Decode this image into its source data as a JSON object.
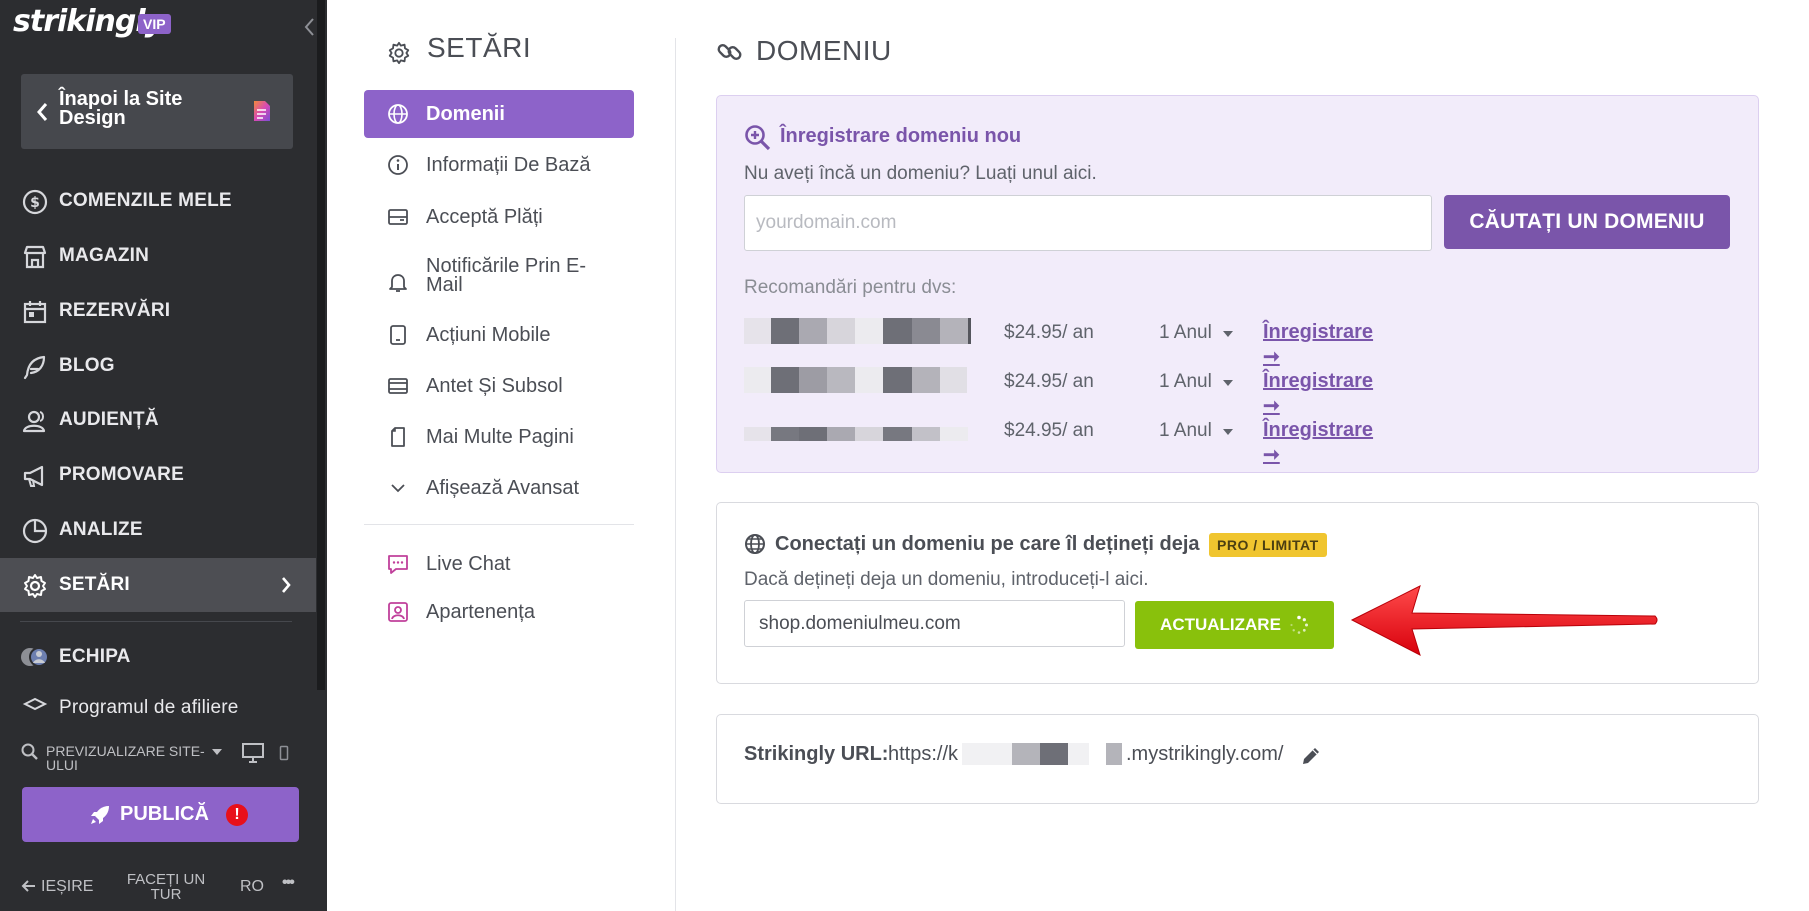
{
  "sidebar": {
    "brand": "strikingly",
    "vip_badge": "VIP",
    "back_button": "Înapoi la Site Design",
    "items": [
      {
        "label": "COMENZILE MELE",
        "icon": "dollar-icon"
      },
      {
        "label": "MAGAZIN",
        "icon": "store-icon"
      },
      {
        "label": "REZERVĂRI",
        "icon": "calendar-icon"
      },
      {
        "label": "BLOG",
        "icon": "feather-icon"
      },
      {
        "label": "AUDIENȚĂ",
        "icon": "users-icon"
      },
      {
        "label": "PROMOVARE",
        "icon": "megaphone-icon"
      },
      {
        "label": "ANALIZE",
        "icon": "pie-chart-icon"
      },
      {
        "label": "SETĂRI",
        "icon": "gear-icon",
        "active": true
      }
    ],
    "team": "ECHIPA",
    "affiliate": "Programul de afiliere",
    "preview_label": "PREVIZUALIZARE SITE-ULUI",
    "publish": "PUBLICĂ",
    "publish_alert": "!",
    "exit": "IEȘIRE",
    "tour": "FACEȚI UN TUR",
    "language": "RO",
    "more": "•••"
  },
  "settings": {
    "title": "SETĂRI",
    "menu": [
      {
        "label": "Domenii",
        "icon": "globe-icon",
        "active": true
      },
      {
        "label": "Informații De Bază",
        "icon": "info-icon"
      },
      {
        "label": "Acceptă Plăți",
        "icon": "wallet-icon"
      },
      {
        "label": "Notificările Prin E-Mail",
        "icon": "bell-icon"
      },
      {
        "label": "Acțiuni Mobile",
        "icon": "tablet-icon"
      },
      {
        "label": "Antet Și Subsol",
        "icon": "layout-icon"
      },
      {
        "label": "Mai Multe Pagini",
        "icon": "pages-icon"
      },
      {
        "label": "Afișează Avansat",
        "icon": "chevron-down-icon"
      }
    ],
    "extras": [
      {
        "label": "Live Chat",
        "icon": "chat-icon"
      },
      {
        "label": "Apartenența",
        "icon": "member-icon"
      }
    ]
  },
  "domain": {
    "title": "DOMENIU",
    "register": {
      "heading": "Înregistrare domeniu nou",
      "sub": "Nu aveți încă un domeniu? Luați unul aici.",
      "placeholder": "yourdomain.com",
      "search_button": "CĂUTAȚI UN DOMENIU",
      "rec_label": "Recomandări pentru dvs:",
      "recommendations": [
        {
          "price": "$24.95/ an",
          "term": "1 Anul",
          "action": "Înregistrare ➞"
        },
        {
          "price": "$24.95/ an",
          "term": "1 Anul",
          "action": "Înregistrare ➞"
        },
        {
          "price": "$24.95/ an",
          "term": "1 Anul",
          "action": "Înregistrare ➞"
        }
      ]
    },
    "connect": {
      "heading": "Conectați un domeniu pe care îl dețineți deja",
      "badge": "PRO / LIMITAT",
      "sub": "Dacă dețineți deja un domeniu, introduceți-l aici.",
      "value": "shop.domeniulmeu.com",
      "update_button": "ACTUALIZARE"
    },
    "url": {
      "label": "Strikingly URL:",
      "prefix": "https://k",
      "suffix": ".mystrikingly.com/"
    }
  },
  "colors": {
    "sidebar_bg": "#2c2d30",
    "accent_purple": "#8d63c9",
    "search_button": "#7a55aa",
    "update_green": "#89c10c",
    "badge_yellow": "#f0c52f",
    "arrow_red": "#e8101a"
  }
}
